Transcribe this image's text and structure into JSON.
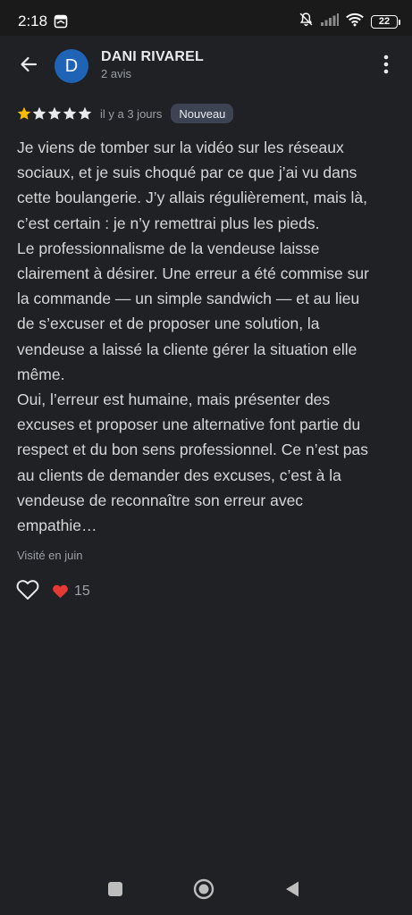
{
  "status_bar": {
    "time": "2:18",
    "battery_level": "22",
    "icons": [
      "gallery-app-icon",
      "bell-off-icon",
      "signal-icon",
      "wifi-icon",
      "battery-icon"
    ]
  },
  "header": {
    "avatar_letter": "D",
    "avatar_color": "#1e63b6",
    "user_name": "DANI RIVAREL",
    "user_reviews": "2 avis",
    "icons": [
      "back-arrow-icon",
      "more-vert-icon"
    ]
  },
  "review": {
    "rating": 1,
    "max_rating": 5,
    "star_filled_color": "#fbbc04",
    "star_empty_color": "#e8eaed",
    "date": "il y a 3 jours",
    "badge": "Nouveau",
    "paragraphs": [
      "Je viens de tomber sur la vidéo sur les réseaux\nsociaux, et je suis choqué par ce que j’ai vu dans\ncette boulangerie. J’y allais régulièrement, mais là,\nc’est certain : je n’y remettrai plus les pieds.",
      "Le professionnalisme de la vendeuse laisse\nclairement à désirer. Une erreur a été commise sur\nla commande — un simple sandwich — et au lieu\nde s’excuser et de proposer une solution, la\nvendeuse a laissé la cliente gérer la situation elle\nmême.",
      "Oui, l’erreur est humaine, mais présenter des\nexcuses et proposer une alternative font partie du\nrespect et du bon sens professionnel. Ce n’est pas\nau clients de demander des excuses, c’est à la\nvendeuse de reconnaître son erreur avec\nempathie…"
    ],
    "visit": "Visité en juin",
    "reaction_count": "15",
    "reaction_icon": "red-heart-icon",
    "like_icon": "heart-outline-icon"
  },
  "nav_bar": {
    "icons": [
      "square-recents-icon",
      "circle-home-icon",
      "triangle-back-icon"
    ]
  }
}
